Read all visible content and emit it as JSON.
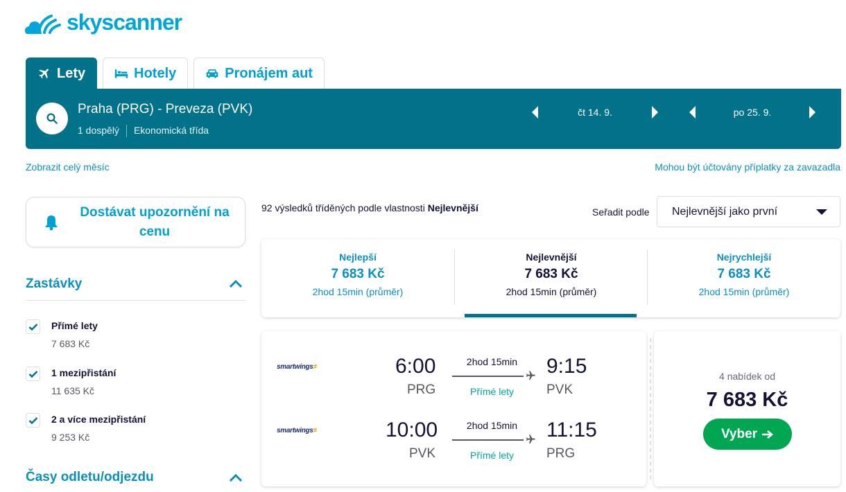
{
  "brand": {
    "name": "skyscanner",
    "color": "#00a5d9"
  },
  "tabs": [
    {
      "label": "Lety",
      "icon": "plane-icon",
      "active": true
    },
    {
      "label": "Hotely",
      "icon": "bed-icon",
      "active": false
    },
    {
      "label": "Pronájem aut",
      "icon": "car-icon",
      "active": false
    }
  ],
  "search": {
    "route": "Praha (PRG) - Preveza (PVK)",
    "passengers": "1 dospělý",
    "cabin": "Ekonomická třída",
    "depart_date": "čt 14. 9.",
    "return_date": "po 25. 9."
  },
  "links": {
    "whole_month": "Zobrazit celý měsíc",
    "baggage_fees": "Mohou být účtovány příplatky za zavazadla"
  },
  "price_alert": {
    "label": "Dostávat upozornění na cenu"
  },
  "filters": {
    "stops_title": "Zastávky",
    "times_title": "Časy odletu/odjezdu",
    "stops": [
      {
        "label": "Přímé lety",
        "price": "7 683 Kč",
        "checked": true
      },
      {
        "label": "1 mezipřistání",
        "price": "11 635 Kč",
        "checked": true
      },
      {
        "label": "2 a více mezipřistání",
        "price": "9 253 Kč",
        "checked": true
      }
    ]
  },
  "results": {
    "count_prefix": "92 výsledků tříděných podle vlastnosti",
    "count_sort": "Nejlevnější",
    "sort_label": "Seřadit podle",
    "sort_value": "Nejlevnější jako první"
  },
  "sort_cards": [
    {
      "label": "Nejlepší",
      "price": "7 683 Kč",
      "duration": "2hod 15min (průměr)",
      "selected": false
    },
    {
      "label": "Nejlevnější",
      "price": "7 683 Kč",
      "duration": "2hod 15min (průměr)",
      "selected": true
    },
    {
      "label": "Nejrychlejší",
      "price": "7 683 Kč",
      "duration": "2hod 15min (průměr)",
      "selected": false
    }
  ],
  "ticket": {
    "airline": "smartwings",
    "outbound": {
      "dep_time": "6:00",
      "dep_code": "PRG",
      "arr_time": "9:15",
      "arr_code": "PVK",
      "duration": "2hod 15min",
      "stops": "Přímé lety"
    },
    "inbound": {
      "dep_time": "10:00",
      "dep_code": "PVK",
      "arr_time": "11:15",
      "arr_code": "PRG",
      "duration": "2hod 15min",
      "stops": "Přímé lety"
    },
    "offers": "4 nabídek od",
    "price": "7 683 Kč",
    "select_label": "Vyber"
  }
}
